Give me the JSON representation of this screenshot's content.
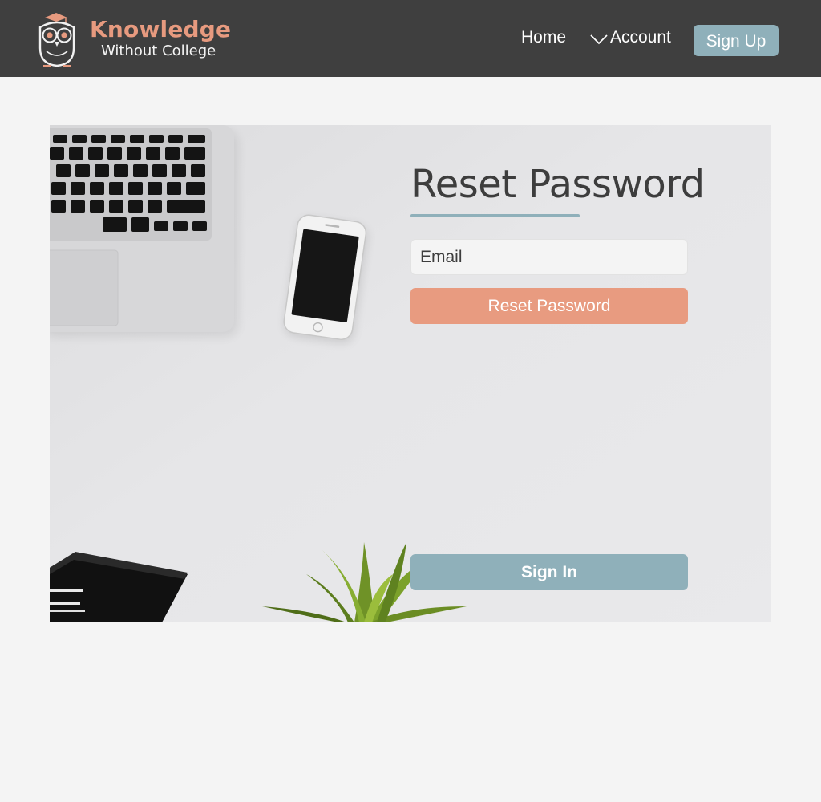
{
  "brand": {
    "name": "Knowledge",
    "tagline": "Without College",
    "logo_icon": "owl-logo-icon",
    "accent_color": "#e79a7f"
  },
  "nav": {
    "home_label": "Home",
    "account_label": "Account",
    "account_icon": "chevron-down-icon",
    "signup_label": "Sign Up",
    "bar_color": "#3f3f3f",
    "button_color": "#8fb0ba"
  },
  "reset_form": {
    "title": "Reset Password",
    "email_placeholder": "Email",
    "email_value": "",
    "submit_label": "Reset Password",
    "submit_color": "#e89b80",
    "signin_label": "Sign In",
    "signin_color": "#8fb0ba"
  }
}
